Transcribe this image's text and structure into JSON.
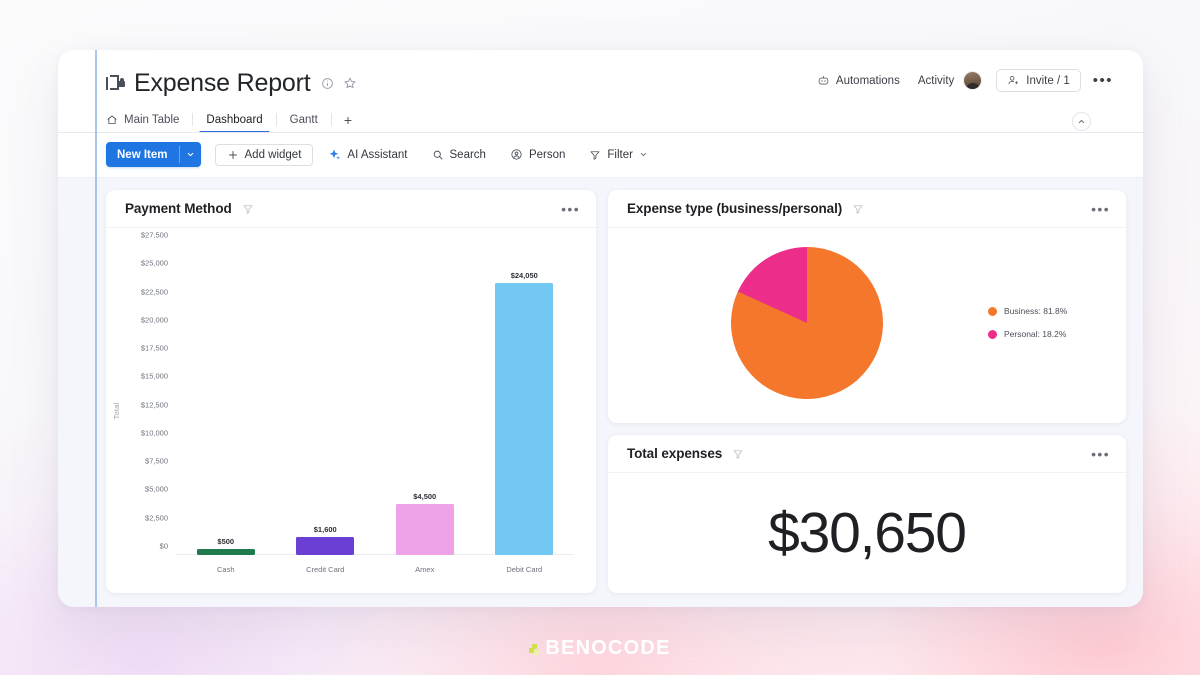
{
  "board": {
    "title": "Expense Report",
    "icon": "board-locked-icon",
    "info_icon": "info-circle-icon",
    "star_icon": "star-outline-icon"
  },
  "header_right": {
    "automations": "Automations",
    "automations_icon": "robot-icon",
    "activity": "Activity",
    "avatar": "user-avatar",
    "invite": "Invite / 1",
    "invite_icon": "person-add-icon",
    "more": "•••",
    "collapse_icon": "chevron-up-icon"
  },
  "tabs": [
    {
      "label": "Main Table",
      "icon": "home-icon",
      "active": false
    },
    {
      "label": "Dashboard",
      "icon": "",
      "active": true
    },
    {
      "label": "Gantt",
      "icon": "",
      "active": false
    }
  ],
  "tab_add": "+",
  "toolbar": {
    "new_item": "New Item",
    "new_item_caret": "chevron-down-icon",
    "add_widget": "Add widget",
    "add_widget_icon": "plus-icon",
    "ai_assistant": "AI Assistant",
    "ai_assistant_icon": "ai-sparkle-icon",
    "search": "Search",
    "search_icon": "magnifier-icon",
    "person": "Person",
    "person_icon": "person-circle-icon",
    "filter": "Filter",
    "filter_icon": "funnel-icon",
    "filter_caret": "chevron-down-icon"
  },
  "widgets": {
    "payment_method": {
      "title": "Payment Method",
      "filter_icon": "funnel-icon",
      "menu": "•••"
    },
    "expense_type": {
      "title": "Expense type (business/personal)",
      "filter_icon": "funnel-icon",
      "menu": "•••"
    },
    "total_expenses": {
      "title": "Total expenses",
      "filter_icon": "funnel-icon",
      "menu": "•••",
      "value": "$30,650"
    }
  },
  "watermark": {
    "text": "BENOCODE"
  },
  "colors": {
    "accent_blue": "#1f76e3",
    "bar_cash": "#1f7a4d",
    "bar_credit_card": "#6c3fd4",
    "bar_amex": "#eea2e8",
    "bar_debit_card": "#72c8f2",
    "pie_business": "#f5772c",
    "pie_personal": "#ec2d8a"
  },
  "chart_data": [
    {
      "type": "bar",
      "title": "Payment Method",
      "categories": [
        "Cash",
        "Credit Card",
        "Amex",
        "Debit Card"
      ],
      "values": [
        500,
        1600,
        4500,
        24050
      ],
      "value_labels": [
        "$500",
        "$1,600",
        "$4,500",
        "$24,050"
      ],
      "colors": [
        "#1f7a4d",
        "#6c3fd4",
        "#eea2e8",
        "#72c8f2"
      ],
      "xlabel": "",
      "ylabel": "Total",
      "ylim": [
        0,
        27500
      ],
      "yticks": [
        0,
        2500,
        5000,
        7500,
        10000,
        12500,
        15000,
        17500,
        20000,
        22500,
        25000,
        27500
      ],
      "ytick_labels": [
        "$0",
        "$2,500",
        "$5,000",
        "$7,500",
        "$10,000",
        "$12,500",
        "$15,000",
        "$17,500",
        "$20,000",
        "$22,500",
        "$25,000",
        "$27,500"
      ],
      "grid": false,
      "legend": "none"
    },
    {
      "type": "pie",
      "title": "Expense type (business/personal)",
      "labels": [
        "Business",
        "Personal"
      ],
      "values": [
        81.8,
        18.2
      ],
      "legend_labels": [
        "Business: 81.8%",
        "Personal: 18.2%"
      ],
      "colors": [
        "#f5772c",
        "#ec2d8a"
      ],
      "legend": "right"
    },
    {
      "type": "table",
      "title": "Total expenses",
      "categories": [
        "Total expenses"
      ],
      "values": [
        30650
      ],
      "value_labels": [
        "$30,650"
      ]
    }
  ]
}
